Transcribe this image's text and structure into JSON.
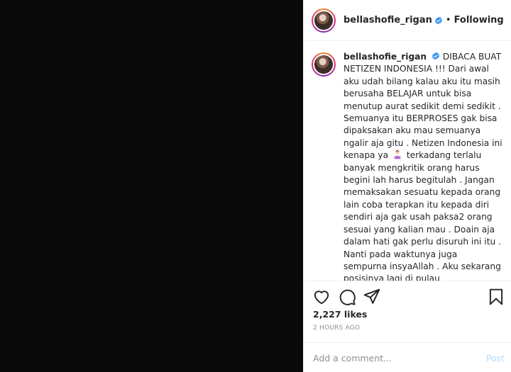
{
  "post": {
    "username": "bellashofie_rigan",
    "verified_icon": "verified-badge-icon",
    "separator": "•",
    "follow_status": "Following"
  },
  "caption": {
    "username": "bellashofie_rigan",
    "text_before_emoji": "DIBACA BUAT NETIZEN INDONESIA !!! Dari awal aku udah bilang kalau aku itu masih berusaha BELAJAR untuk bisa menutup aurat sedikit demi sedikit . Semuanya itu BERPROSES gak bisa dipaksakan aku mau semuanya ngalir aja gitu . Netizen Indonesia ini kenapa ya",
    "emoji_icon": "person-shrugging-emoji-icon",
    "text_after_emoji": "terkadang terlalu banyak mengkritik orang harus begini lah harus begitulah . Jangan memaksakan sesuatu kepada orang lain coba terapkan itu kepada diri sendiri aja gak usah paksa2 orang sesuai yang kalian mau . Doain aja dalam hati gak perlu disuruh ini itu . Nanti pada waktunya juga sempurna insyaAllah . Aku sekarang posisinya lagi di pulau"
  },
  "actions": {
    "like_icon": "heart-icon",
    "comment_icon": "comment-icon",
    "share_icon": "share-icon",
    "save_icon": "bookmark-icon"
  },
  "stats": {
    "likes": "2,227 likes",
    "timestamp": "2 HOURS AGO"
  },
  "comment": {
    "placeholder": "Add a comment...",
    "post_label": "Post"
  },
  "colors": {
    "media_background": "#0a0a0a",
    "verified_blue": "#3897f0",
    "post_button_disabled": "#b3dbff",
    "muted_text": "#8e8e8e"
  }
}
